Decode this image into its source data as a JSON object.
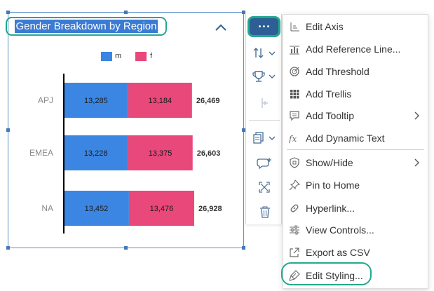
{
  "widget": {
    "title": "Gender Breakdown by Region"
  },
  "legend": [
    {
      "label": "m",
      "color": "#3b86e3"
    },
    {
      "label": "f",
      "color": "#e8487a"
    }
  ],
  "chart_data": {
    "type": "bar",
    "orientation": "horizontal",
    "stacked": true,
    "categories": [
      "APJ",
      "EMEA",
      "NA"
    ],
    "series": [
      {
        "name": "m",
        "values": [
          13285,
          13228,
          13452
        ],
        "color": "#3b86e3"
      },
      {
        "name": "f",
        "values": [
          13184,
          13375,
          13476
        ],
        "color": "#e8487a"
      }
    ],
    "totals": [
      26469,
      26603,
      26928
    ],
    "value_labels": {
      "m": [
        "13,285",
        "13,228",
        "13,452"
      ],
      "f": [
        "13,184",
        "13,375",
        "13,476"
      ],
      "totals": [
        "26,469",
        "26,603",
        "26,928"
      ]
    },
    "grid": false,
    "legend_position": "top"
  },
  "toolbar": {
    "more_button": "•••",
    "icons": [
      "sort-icon",
      "ranking-trophy-icon",
      "drill-icon",
      "copy-icon",
      "add-comment-icon",
      "fullscreen-icon",
      "delete-icon"
    ]
  },
  "menu": {
    "items": [
      {
        "label": "Edit Axis",
        "icon": "edit-axis-icon",
        "submenu": false
      },
      {
        "label": "Add Reference Line...",
        "icon": "reference-line-icon",
        "submenu": false
      },
      {
        "label": "Add Threshold",
        "icon": "threshold-icon",
        "submenu": false
      },
      {
        "label": "Add Trellis",
        "icon": "trellis-icon",
        "submenu": false
      },
      {
        "label": "Add Tooltip",
        "icon": "tooltip-icon",
        "submenu": true
      },
      {
        "label": "Add Dynamic Text",
        "icon": "dynamic-text-icon",
        "submenu": false
      },
      {
        "label": "Show/Hide",
        "icon": "show-hide-icon",
        "submenu": true
      },
      {
        "label": "Pin to Home",
        "icon": "pin-icon",
        "submenu": false
      },
      {
        "label": "Hyperlink...",
        "icon": "hyperlink-icon",
        "submenu": false
      },
      {
        "label": "View Controls...",
        "icon": "view-controls-icon",
        "submenu": false
      },
      {
        "label": "Export as CSV",
        "icon": "export-icon",
        "submenu": false
      },
      {
        "label": "Edit Styling...",
        "icon": "edit-styling-icon",
        "submenu": false
      }
    ]
  },
  "colors": {
    "accent_highlight": "#24a88f",
    "selection": "#3b7bd3",
    "more_button_bg": "#2d5f96"
  }
}
